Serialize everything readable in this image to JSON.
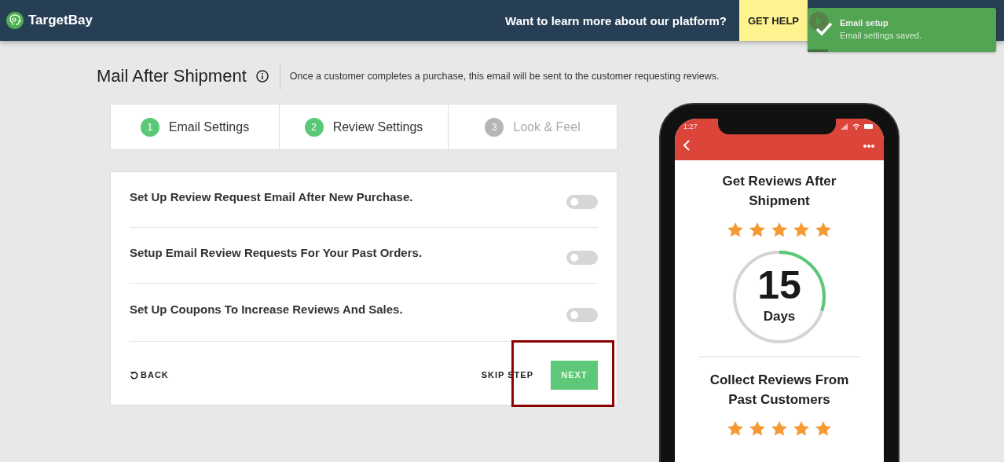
{
  "header": {
    "brand": "TargetBay",
    "prompt": "Want to learn more about our platform?",
    "help_button": "GET HELP"
  },
  "toast": {
    "title": "Email setup",
    "message": "Email settings saved.",
    "level": 0.11
  },
  "page": {
    "title": "Mail After Shipment",
    "description": "Once a customer completes a purchase, this email will be sent to the customer requesting reviews."
  },
  "steps": [
    {
      "number": "1",
      "label": "Email Settings",
      "done": true
    },
    {
      "number": "2",
      "label": "Review Settings",
      "done": true
    },
    {
      "number": "3",
      "label": "Look & Feel",
      "done": false
    }
  ],
  "settings": [
    {
      "label": "Set Up Review Request Email After New Purchase.",
      "on": false
    },
    {
      "label": "Setup Email Review Requests For Your Past Orders.",
      "on": false
    },
    {
      "label": "Set Up Coupons To Increase Reviews And Sales.",
      "on": false
    }
  ],
  "footer": {
    "back": "BACK",
    "skip": "SKIP STEP",
    "next": "NEXT"
  },
  "preview": {
    "time": "1:27",
    "sections": [
      {
        "title": "Get Reviews After Shipment",
        "stars": 5
      },
      {
        "title": "Collect Reviews From Past Customers",
        "stars": 5
      }
    ],
    "countdown": {
      "value": "15",
      "unit": "Days",
      "level": 0.3
    }
  }
}
